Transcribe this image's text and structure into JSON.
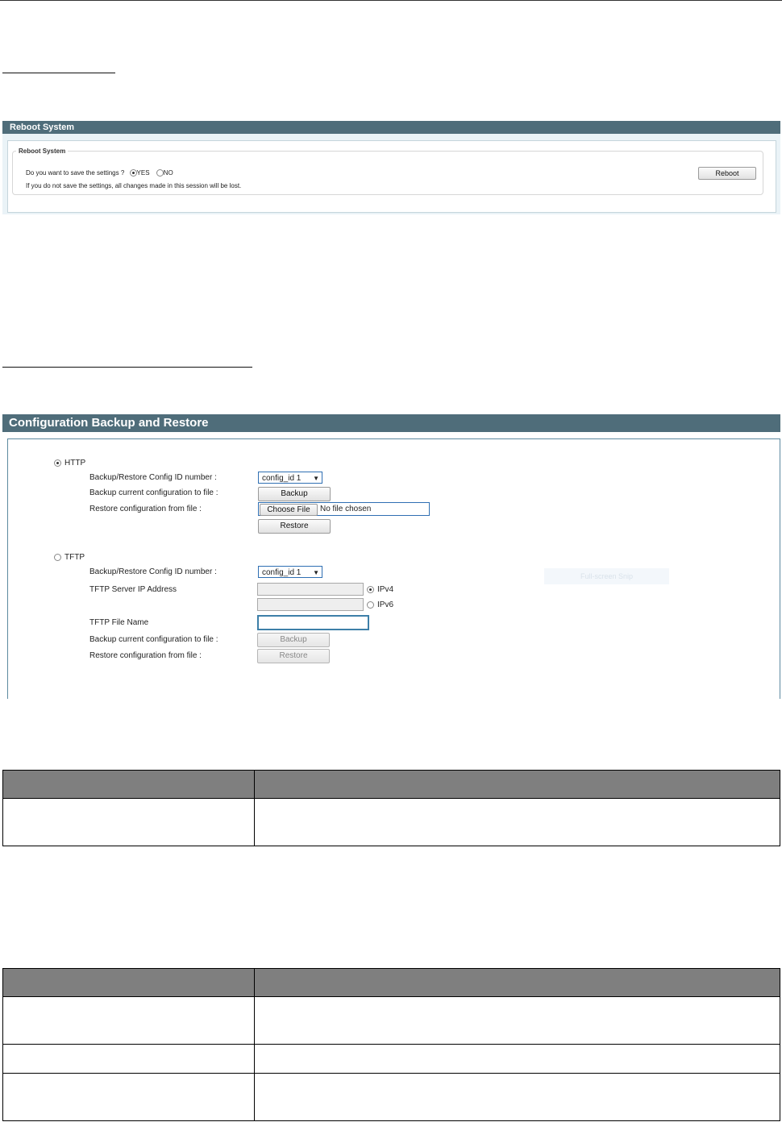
{
  "reboot": {
    "header": "Reboot System",
    "legend": "Reboot System",
    "question": "Do you want to save the settings ?",
    "yes_label": "YES",
    "no_label": "NO",
    "note": "If you do not save the settings, all changes made in this session will be lost.",
    "reboot_button": "Reboot",
    "selected": "YES"
  },
  "config": {
    "header": "Configuration Backup and Restore",
    "http": {
      "label": "HTTP",
      "selected": true,
      "config_id_label": "Backup/Restore Config ID number :",
      "config_id_value": "config_id 1",
      "backup_label": "Backup current configuration to file :",
      "backup_button": "Backup",
      "restore_label": "Restore configuration from file :",
      "choose_file_button": "Choose File",
      "no_file_text": "No file chosen",
      "restore_button": "Restore"
    },
    "tftp": {
      "label": "TFTP",
      "selected": false,
      "config_id_label": "Backup/Restore Config ID number :",
      "config_id_value": "config_id 1",
      "server_ip_label": "TFTP Server IP Address",
      "ipv4_label": "IPv4",
      "ipv6_label": "IPv6",
      "file_name_label": "TFTP File Name",
      "backup_label": "Backup current configuration to file :",
      "backup_button": "Backup",
      "restore_label": "Restore configuration from file :",
      "restore_button": "Restore"
    },
    "overlay_text": "Full-screen Snip"
  },
  "colors": {
    "panel_header": "#4f6d7a",
    "table_header": "#7f7f7f"
  }
}
